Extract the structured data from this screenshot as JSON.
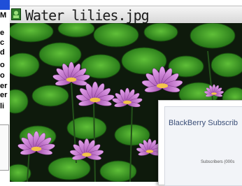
{
  "window": {
    "title": "Water lilies.jpg",
    "icon": "image-file-icon"
  },
  "left_panel": {
    "letters": [
      "M",
      "e",
      "c",
      "d",
      "o",
      "o",
      "er",
      "er",
      "li"
    ]
  },
  "popup": {
    "heading": "BlackBerry Subscrib",
    "subtext": "Subscribers (000s"
  },
  "colors": {
    "title_bar": "#e6e6e6",
    "selection_blue": "#1f4fd8",
    "popup_heading": "#3a4e78",
    "pond_water": "#0e1a0c",
    "lily_pad": "#2f8a1e",
    "petal": "#d68ae0"
  }
}
